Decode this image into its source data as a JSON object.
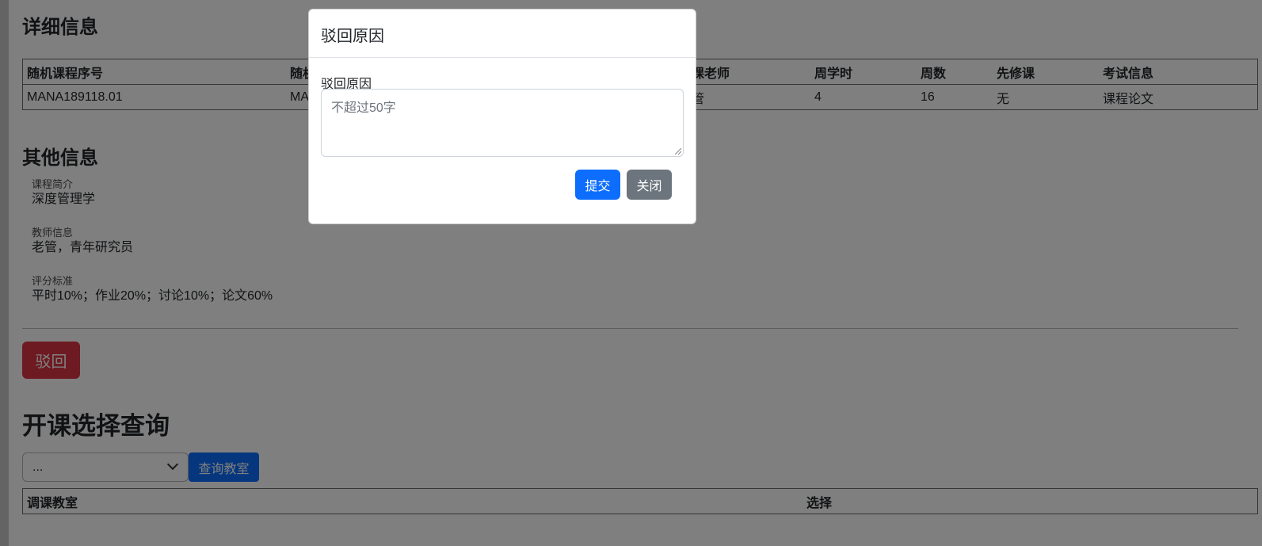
{
  "detail": {
    "title": "详细信息",
    "columns": [
      "随机课程序号",
      "随机",
      "课老师",
      "周学时",
      "周数",
      "先修课",
      "考试信息"
    ],
    "row": [
      "MANA189118.01",
      "MA",
      "管",
      "4",
      "16",
      "无",
      "课程论文"
    ]
  },
  "other": {
    "title": "其他信息",
    "items": [
      {
        "label": "课程简介",
        "value": "深度管理学"
      },
      {
        "label": "教师信息",
        "value": "老管，青年研究员"
      },
      {
        "label": "评分标准",
        "value": "平时10%；作业20%；讨论10%；论文60%"
      }
    ]
  },
  "reject_button": "驳回",
  "query": {
    "title": "开课选择查询",
    "select_value": "...",
    "query_button": "查询教室",
    "columns": [
      "调课教室",
      "选择"
    ]
  },
  "modal": {
    "title": "驳回原因",
    "field_label": "驳回原因",
    "placeholder": "不超过50字",
    "submit": "提交",
    "close": "关闭"
  },
  "colors": {
    "primary": "#0d6efd",
    "danger": "#dc3545",
    "secondary": "#6c757d"
  }
}
